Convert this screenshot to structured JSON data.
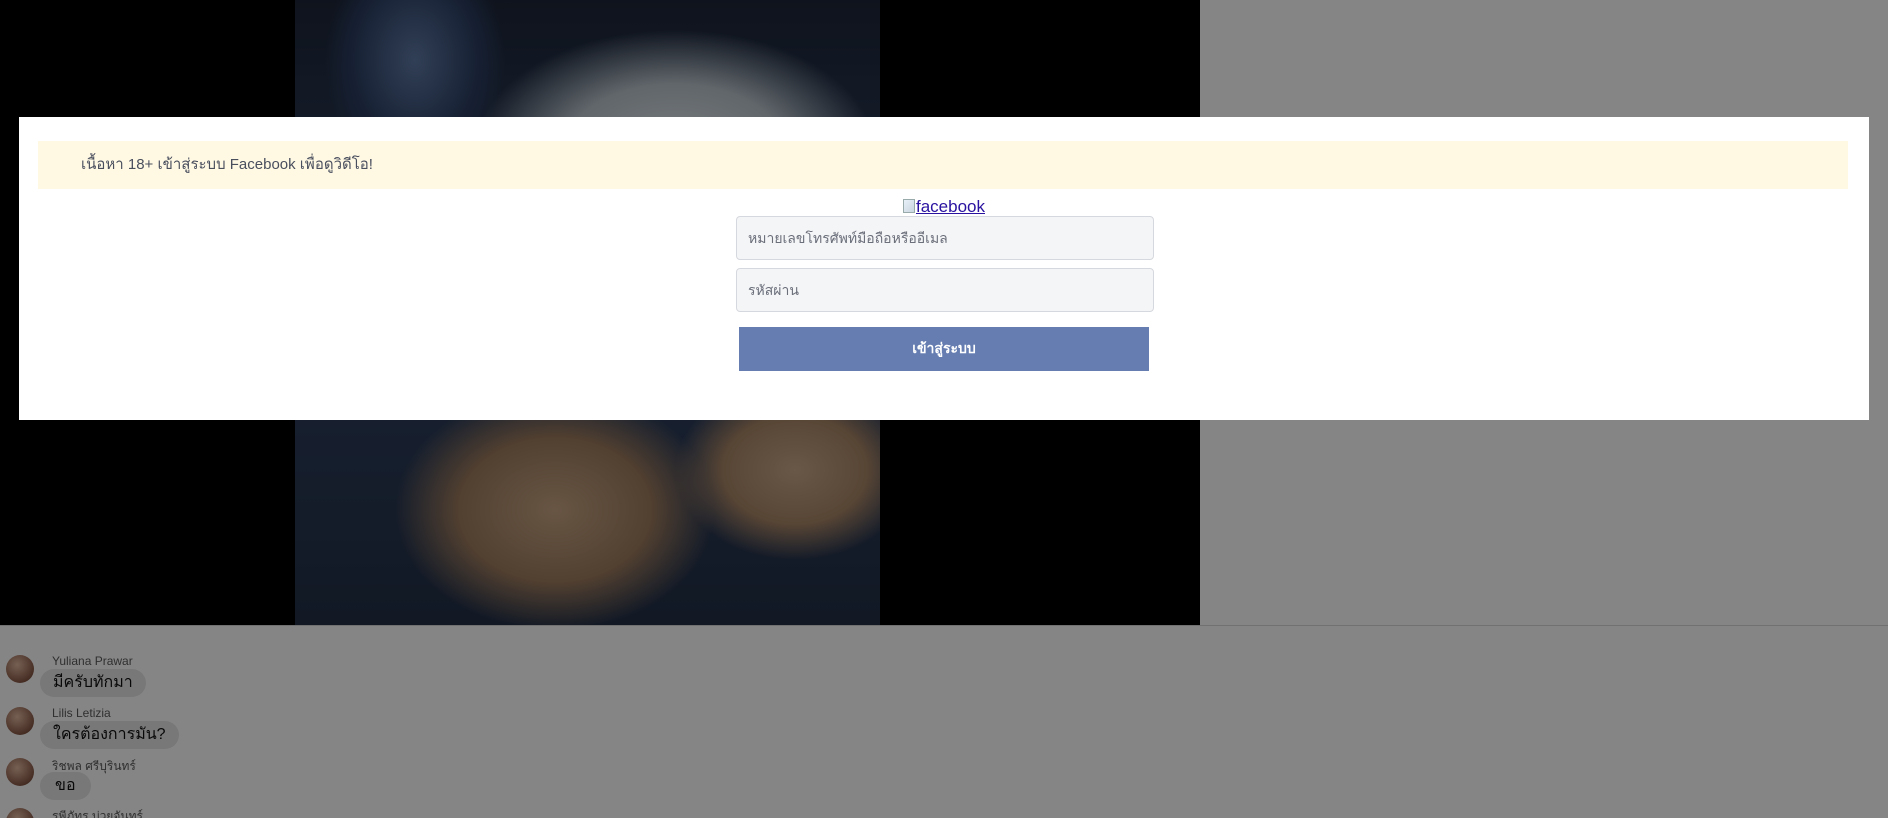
{
  "modal": {
    "notice": "เนื้อหา 18+ เข้าสู่ระบบ Facebook เพื่อดูวิดีโอ!",
    "logo_alt": "facebook",
    "email_placeholder": "หมายเลขโทรศัพท์มือถือหรืออีเมล",
    "password_placeholder": "รหัสผ่าน",
    "login_label": "เข้าสู่ระบบ",
    "login_color": "#657db1",
    "notice_bg": "#fff9e4"
  },
  "comments": [
    {
      "name": "Yuliana Prawar",
      "text": "มีครับทักมา"
    },
    {
      "name": "Lilis Letizia",
      "text": "ใครต้องการมัน?"
    },
    {
      "name": "ริชพล ศรีบุรินทร์",
      "text": "ขอ"
    },
    {
      "name": "รพีภัทร บ่วยจันทร์",
      "text": ""
    }
  ]
}
